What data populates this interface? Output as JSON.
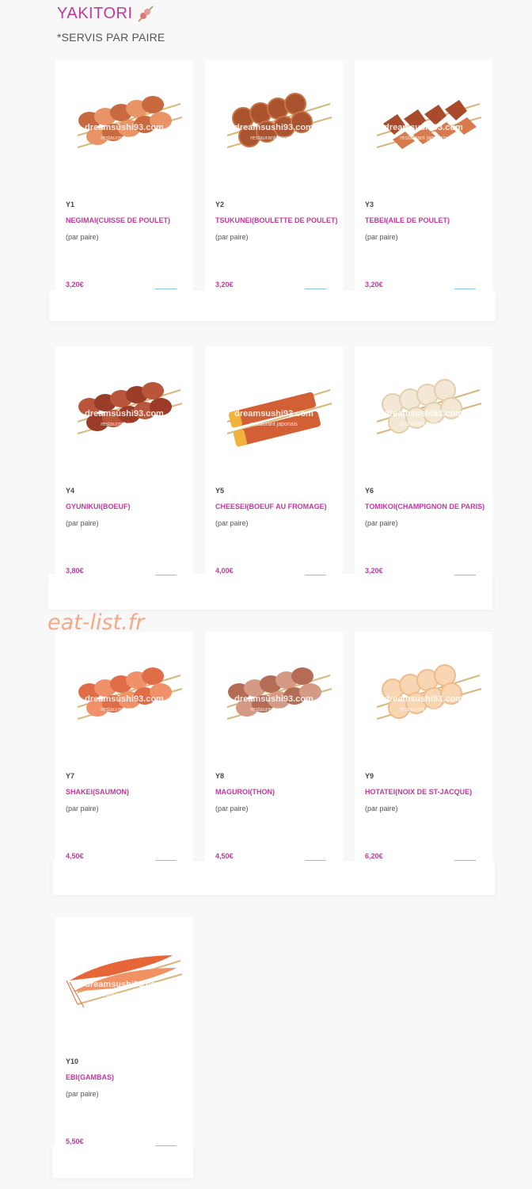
{
  "page": {
    "title": "YAKITORI",
    "subtitle": "*SERVIS PAR PAIRE",
    "watermark": "eat-list.fr"
  },
  "image_watermark": {
    "line1": "dreamsushi93.com",
    "line2": "restaurant japonais"
  },
  "items": [
    {
      "code": "Y1",
      "name": "NEGIMAI(CUISSE DE POULET)",
      "desc": "(par paire)",
      "price": "3,20€",
      "image": "chicken-thigh-skewer"
    },
    {
      "code": "Y2",
      "name": "TSUKUNEI(BOULETTE DE POULET)",
      "desc": "(par paire)",
      "price": "3,20€",
      "image": "chicken-meatball-skewer"
    },
    {
      "code": "Y3",
      "name": "TEBEI(AILE DE POULET)",
      "desc": "(par paire)",
      "price": "3,20€",
      "image": "chicken-wing-skewer"
    },
    {
      "code": "Y4",
      "name": "GYUNIKUI(BOEUF)",
      "desc": "(par paire)",
      "price": "3,80€",
      "image": "beef-skewer"
    },
    {
      "code": "Y5",
      "name": "CHEESEI(BOEUF AU FROMAGE)",
      "desc": "(par paire)",
      "price": "4,00€",
      "image": "beef-cheese-skewer"
    },
    {
      "code": "Y6",
      "name": "TOMIKOI(CHAMPIGNON DE PARIS)",
      "desc": "(par paire)",
      "price": "3,20€",
      "image": "mushroom-skewer"
    },
    {
      "code": "Y7",
      "name": "SHAKEI(SAUMON)",
      "desc": "(par paire)",
      "price": "4,50€",
      "image": "salmon-skewer"
    },
    {
      "code": "Y8",
      "name": "MAGUROI(THON)",
      "desc": "(par paire)",
      "price": "4,50€",
      "image": "tuna-skewer"
    },
    {
      "code": "Y9",
      "name": "HOTATEI(NOIX DE ST-JACQUE)",
      "desc": "(par paire)",
      "price": "6,20€",
      "image": "scallop-skewer"
    },
    {
      "code": "Y10",
      "name": "EBI(GAMBAS)",
      "desc": "(par paire)",
      "price": "5,50€",
      "image": "shrimp-skewer"
    }
  ]
}
